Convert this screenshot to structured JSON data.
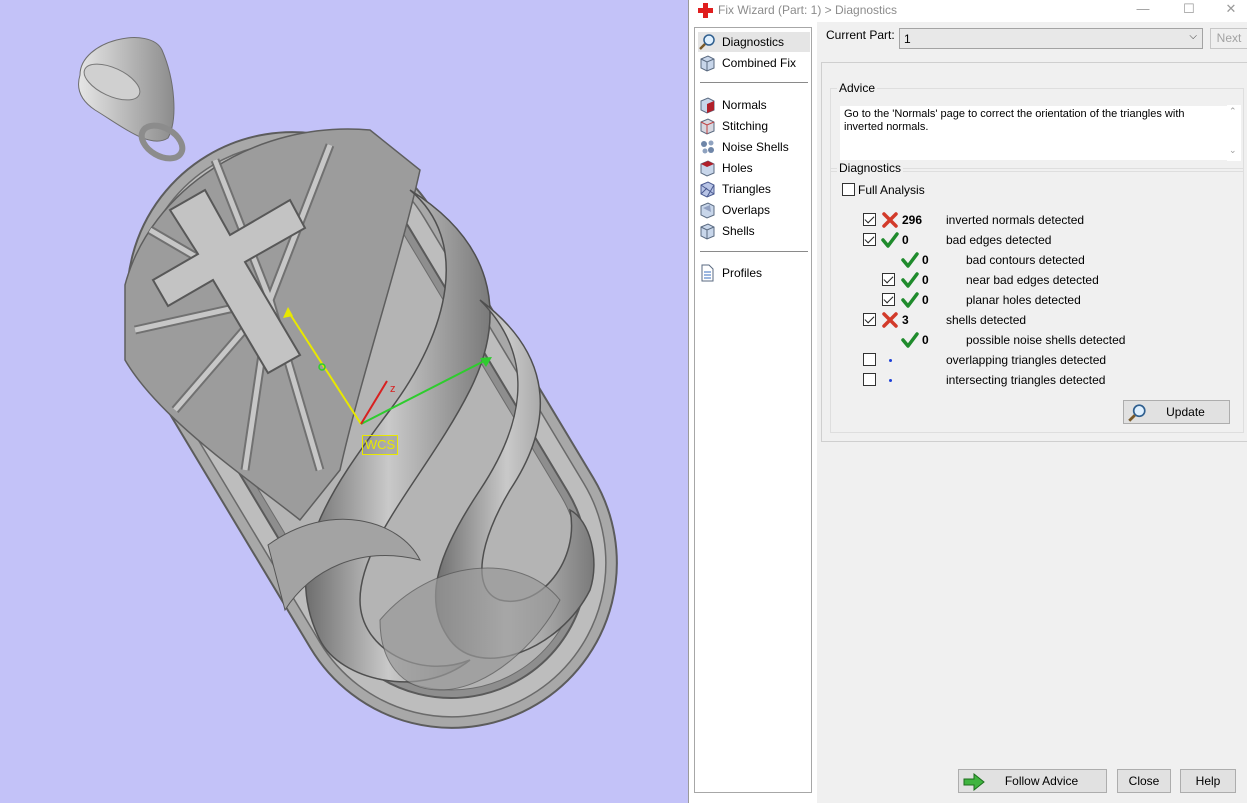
{
  "window": {
    "title": "Fix Wizard (Part: 1) > Diagnostics",
    "min_glyph": "—",
    "max_glyph": "☐",
    "close_glyph": "✕"
  },
  "viewport": {
    "wcs_label": "WCS",
    "z_axis_label": "z"
  },
  "nav": {
    "items": [
      {
        "label": "Diagnostics",
        "icon": "magnifier-icon"
      },
      {
        "label": "Combined Fix",
        "icon": "cube-icon"
      },
      {
        "label": "Normals",
        "icon": "normals-cube-icon"
      },
      {
        "label": "Stitching",
        "icon": "stitching-cube-icon"
      },
      {
        "label": "Noise Shells",
        "icon": "noise-shells-icon"
      },
      {
        "label": "Holes",
        "icon": "holes-cube-icon"
      },
      {
        "label": "Triangles",
        "icon": "triangles-cube-icon"
      },
      {
        "label": "Overlaps",
        "icon": "overlaps-cube-icon"
      },
      {
        "label": "Shells",
        "icon": "shells-cube-icon"
      },
      {
        "label": "Profiles",
        "icon": "document-icon"
      }
    ]
  },
  "current_part": {
    "label": "Current Part:",
    "value": "1",
    "next_label": "Next"
  },
  "advice": {
    "title": "Advice",
    "line1": "Go to the 'Normals' page to correct the orientation of the triangles with",
    "line2": "inverted normals."
  },
  "diagnostics": {
    "title": "Diagnostics",
    "full_analysis": "Full Analysis",
    "rows": [
      {
        "checked": true,
        "status": "error",
        "value": "296",
        "label": "inverted normals detected"
      },
      {
        "checked": true,
        "status": "ok",
        "value": "0",
        "label": "bad edges detected"
      },
      {
        "checked": null,
        "status": "ok",
        "value": "0",
        "label": "bad contours detected"
      },
      {
        "checked": true,
        "status": "ok",
        "value": "0",
        "label": "near bad edges detected"
      },
      {
        "checked": true,
        "status": "ok",
        "value": "0",
        "label": "planar holes detected"
      },
      {
        "checked": true,
        "status": "error",
        "value": "3",
        "label": "shells detected"
      },
      {
        "checked": null,
        "status": "ok",
        "value": "0",
        "label": "possible noise shells detected"
      },
      {
        "checked": false,
        "status": "none",
        "value": "",
        "label": "overlapping triangles detected"
      },
      {
        "checked": false,
        "status": "none",
        "value": "",
        "label": "intersecting triangles detected"
      }
    ],
    "update_label": "Update"
  },
  "footer": {
    "follow_advice": "Follow Advice",
    "close": "Close",
    "help": "Help"
  },
  "colors": {
    "viewport_bg": "#c3c2f8",
    "ok": "#1f8b2c",
    "error": "#d23a2a",
    "wcs": "#e8e800"
  }
}
